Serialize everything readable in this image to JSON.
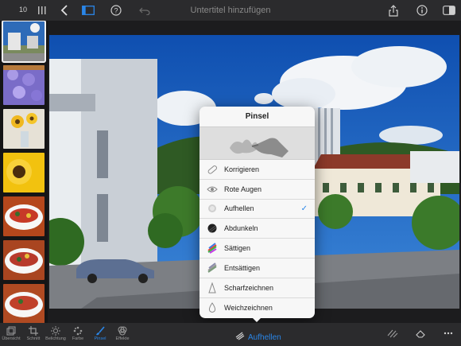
{
  "topbar": {
    "count": "10",
    "subtitle_placeholder": "Untertitel hinzufügen"
  },
  "popover": {
    "title": "Pinsel",
    "items": [
      {
        "label": "Korrigieren",
        "icon": "bandage-icon",
        "selected": false
      },
      {
        "label": "Rote Augen",
        "icon": "eye-icon",
        "selected": false
      },
      {
        "label": "Aufhellen",
        "icon": "lighten-brush-icon",
        "selected": true
      },
      {
        "label": "Abdunkeln",
        "icon": "darken-brush-icon",
        "selected": false
      },
      {
        "label": "Sättigen",
        "icon": "saturate-brush-icon",
        "selected": false
      },
      {
        "label": "Entsättigen",
        "icon": "desaturate-brush-icon",
        "selected": false
      },
      {
        "label": "Scharfzeichnen",
        "icon": "sharpen-icon",
        "selected": false
      },
      {
        "label": "Weichzeichnen",
        "icon": "blur-drop-icon",
        "selected": false
      }
    ],
    "check": "✓"
  },
  "bottombar": {
    "tools": [
      {
        "label": "Übersicht",
        "icon": "overview-icon"
      },
      {
        "label": "Schnitt",
        "icon": "crop-icon"
      },
      {
        "label": "Belichtung",
        "icon": "exposure-icon"
      },
      {
        "label": "Farbe",
        "icon": "color-icon"
      },
      {
        "label": "Pinsel",
        "icon": "brush-icon"
      },
      {
        "label": "Effekte",
        "icon": "effects-icon"
      }
    ],
    "active_tool": "Pinsel",
    "mode_label": "Aufhellen"
  },
  "colors": {
    "accent": "#2a86e8",
    "toolbar_bg": "#2b2b2d",
    "popover_bg": "#f7f7f7"
  }
}
